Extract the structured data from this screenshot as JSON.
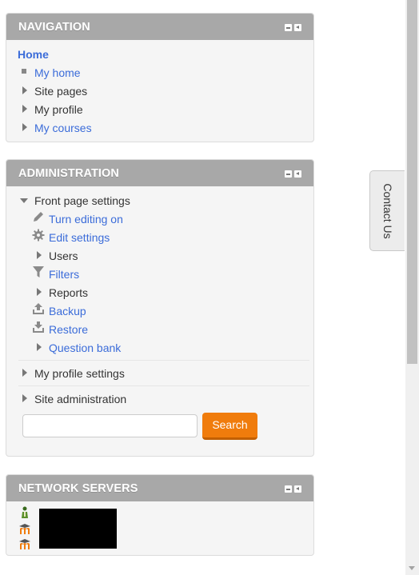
{
  "navigation": {
    "title": "NAVIGATION",
    "items": [
      {
        "label": "Home",
        "icon": "none",
        "link": true
      },
      {
        "label": "My home",
        "icon": "square-bullet-icon",
        "link": true
      },
      {
        "label": "Site pages",
        "icon": "expand-arrow-icon",
        "link": false
      },
      {
        "label": "My profile",
        "icon": "expand-arrow-icon",
        "link": false
      },
      {
        "label": "My courses",
        "icon": "expand-arrow-icon",
        "link": true
      }
    ]
  },
  "administration": {
    "title": "ADMINISTRATION",
    "front_page_settings": "Front page settings",
    "items": [
      {
        "label": "Turn editing on",
        "icon": "pencil-icon",
        "link": true
      },
      {
        "label": "Edit settings",
        "icon": "gear-icon",
        "link": true
      },
      {
        "label": "Users",
        "icon": "expand-arrow-icon",
        "link": false
      },
      {
        "label": "Filters",
        "icon": "filter-icon",
        "link": true
      },
      {
        "label": "Reports",
        "icon": "expand-arrow-icon",
        "link": false
      },
      {
        "label": "Backup",
        "icon": "upload-icon",
        "link": true
      },
      {
        "label": "Restore",
        "icon": "download-icon",
        "link": true
      },
      {
        "label": "Question bank",
        "icon": "expand-arrow-icon",
        "link": true
      }
    ],
    "my_profile_settings": "My profile settings",
    "site_administration": "Site administration",
    "search": {
      "placeholder": "",
      "value": "",
      "button_label": "Search"
    }
  },
  "network_servers": {
    "title": "NETWORK SERVERS",
    "icons": [
      "person-server-icon",
      "moodle-hat-icon",
      "moodle-hat-icon"
    ]
  },
  "contact_tab": {
    "label": "Contact Us"
  },
  "colors": {
    "header": "#a8a8a8",
    "link": "#3b6cd9",
    "search_button": "#f07c0c",
    "block_bg": "#f5f5f5"
  }
}
